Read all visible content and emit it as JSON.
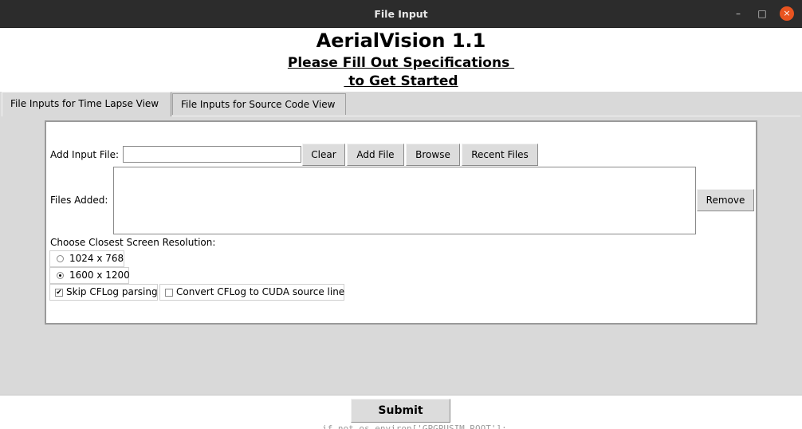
{
  "window": {
    "title": "File Input",
    "controls": {
      "minimize": "–",
      "maximize": "□",
      "close": "×"
    }
  },
  "header": {
    "app_title": "AerialVision 1.1",
    "subtitle_line1": "Please Fill Out Specifications ",
    "subtitle_line2": " to Get Started"
  },
  "tabs": [
    {
      "label": "File Inputs for Time Lapse View",
      "active": true
    },
    {
      "label": "File Inputs for Source Code View",
      "active": false
    }
  ],
  "form": {
    "add_input_label": "Add Input File:",
    "add_input_value": "",
    "buttons": {
      "clear": "Clear",
      "add_file": "Add File",
      "browse": "Browse",
      "recent_files": "Recent Files",
      "remove": "Remove"
    },
    "files_added_label": "Files Added:",
    "files_added": [],
    "resolution_label": "Choose Closest Screen Resolution:",
    "resolutions": [
      {
        "label": "1024 x 768",
        "selected": false
      },
      {
        "label": "1600 x 1200",
        "selected": true
      }
    ],
    "options": [
      {
        "label": "Skip CFLog parsing",
        "checked": true
      },
      {
        "label": "Convert CFLog to CUDA source line",
        "checked": false
      }
    ]
  },
  "footer": {
    "submit_label": "Submit"
  },
  "background_text": "if not os.environ['GPGPUSIM_ROOT']:"
}
